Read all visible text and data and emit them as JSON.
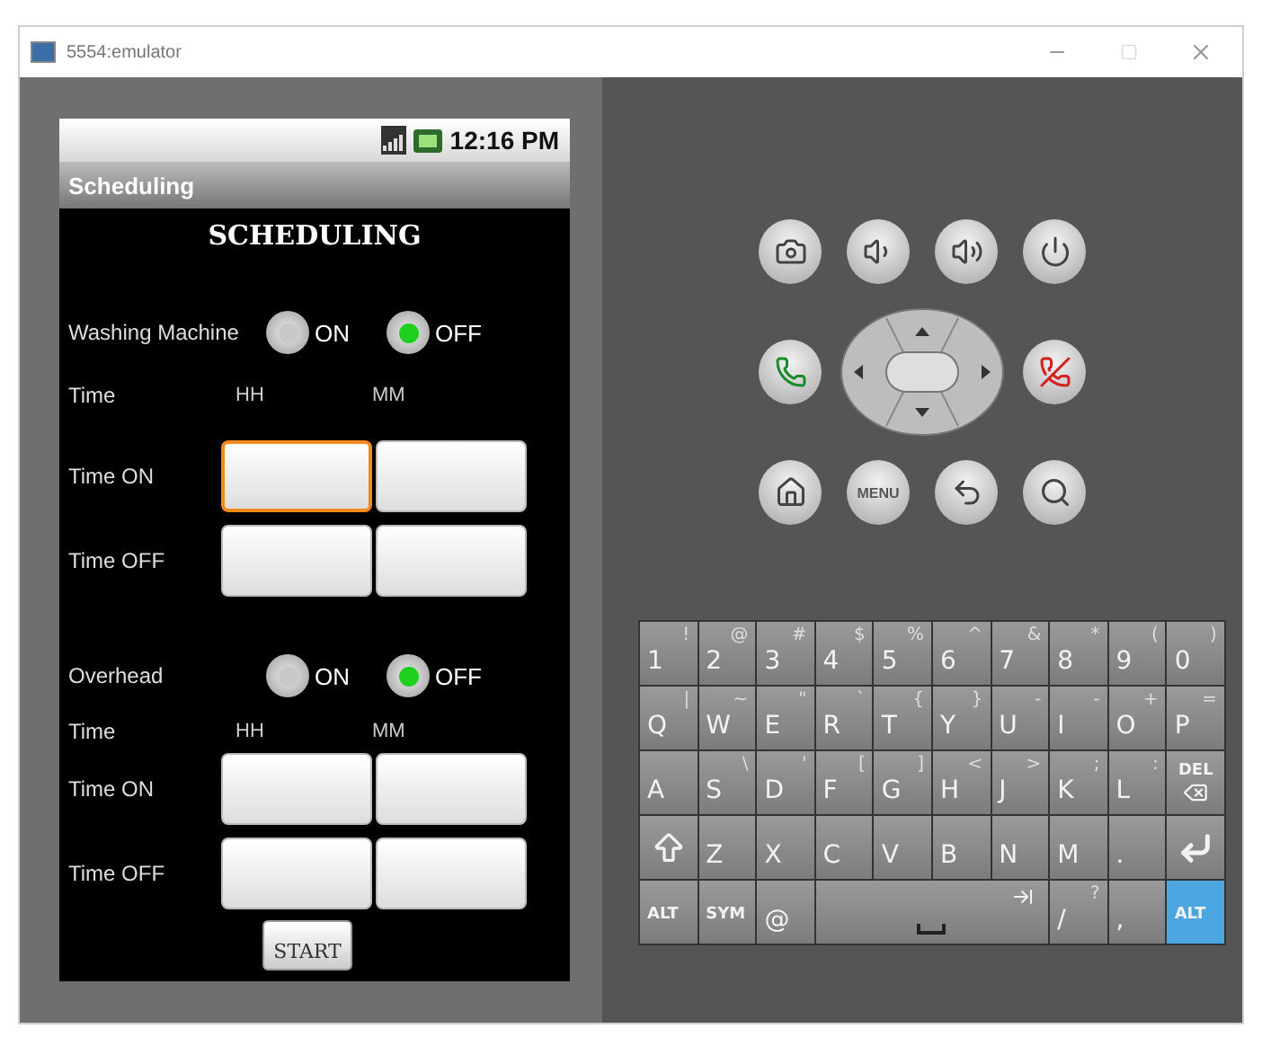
{
  "window": {
    "title": "5554:emulator"
  },
  "phone": {
    "status_time": "12:16 PM",
    "app_title": "Scheduling",
    "heading": "SCHEDULING",
    "devices": [
      {
        "name": "Washing Machine",
        "options": [
          {
            "label": "ON",
            "selected": false
          },
          {
            "label": "OFF",
            "selected": true
          }
        ],
        "time_label": "Time",
        "columns": [
          "HH",
          "MM"
        ],
        "rows": [
          {
            "label": "Time ON",
            "fields": [
              {
                "focused": true
              },
              {
                "focused": false
              }
            ]
          },
          {
            "label": "Time OFF",
            "fields": [
              {
                "focused": false
              },
              {
                "focused": false
              }
            ]
          }
        ]
      },
      {
        "name": "Overhead",
        "options": [
          {
            "label": "ON",
            "selected": false
          },
          {
            "label": "OFF",
            "selected": true
          }
        ],
        "time_label": "Time",
        "columns": [
          "HH",
          "MM"
        ],
        "rows": [
          {
            "label": "Time ON",
            "fields": [
              {
                "focused": false
              },
              {
                "focused": false
              }
            ]
          },
          {
            "label": "Time OFF",
            "fields": [
              {
                "focused": false
              },
              {
                "focused": false
              }
            ]
          }
        ]
      }
    ],
    "start_button": "START"
  },
  "hardware_buttons": [
    [
      {
        "kind": "camera"
      },
      {
        "kind": "volume-down"
      },
      {
        "kind": "volume-up"
      },
      {
        "kind": "power"
      }
    ],
    [
      {
        "kind": "call"
      },
      {
        "kind": "dpad"
      },
      {
        "kind": "end-call"
      }
    ],
    [
      {
        "kind": "home"
      },
      {
        "kind": "menu",
        "label": "MENU"
      },
      {
        "kind": "back"
      },
      {
        "kind": "search"
      }
    ]
  ],
  "keyboard": [
    [
      {
        "kind": "char",
        "main": "1",
        "alt": "!"
      },
      {
        "kind": "char",
        "main": "2",
        "alt": "@"
      },
      {
        "kind": "char",
        "main": "3",
        "alt": "#"
      },
      {
        "kind": "char",
        "main": "4",
        "alt": "$"
      },
      {
        "kind": "char",
        "main": "5",
        "alt": "%"
      },
      {
        "kind": "char",
        "main": "6",
        "alt": "^"
      },
      {
        "kind": "char",
        "main": "7",
        "alt": "&"
      },
      {
        "kind": "char",
        "main": "8",
        "alt": "*"
      },
      {
        "kind": "char",
        "main": "9",
        "alt": "("
      },
      {
        "kind": "char",
        "main": "0",
        "alt": ")"
      }
    ],
    [
      {
        "kind": "char",
        "main": "Q",
        "alt": "|"
      },
      {
        "kind": "char",
        "main": "W",
        "alt": "~"
      },
      {
        "kind": "char",
        "main": "E",
        "alt": "\""
      },
      {
        "kind": "char",
        "main": "R",
        "alt": "`"
      },
      {
        "kind": "char",
        "main": "T",
        "alt": "{"
      },
      {
        "kind": "char",
        "main": "Y",
        "alt": "}"
      },
      {
        "kind": "char",
        "main": "U",
        "alt": "-"
      },
      {
        "kind": "char",
        "main": "I",
        "alt": "-"
      },
      {
        "kind": "char",
        "main": "O",
        "alt": "+"
      },
      {
        "kind": "char",
        "main": "P",
        "alt": "="
      }
    ],
    [
      {
        "kind": "char",
        "main": "A"
      },
      {
        "kind": "char",
        "main": "S",
        "alt": "\\"
      },
      {
        "kind": "char",
        "main": "D",
        "alt": "'"
      },
      {
        "kind": "char",
        "main": "F",
        "alt": "["
      },
      {
        "kind": "char",
        "main": "G",
        "alt": "]"
      },
      {
        "kind": "char",
        "main": "H",
        "alt": "<"
      },
      {
        "kind": "char",
        "main": "J",
        "alt": ">"
      },
      {
        "kind": "char",
        "main": "K",
        "alt": ";"
      },
      {
        "kind": "char",
        "main": "L",
        "alt": ":"
      },
      {
        "kind": "delete",
        "main": "DEL"
      }
    ],
    [
      {
        "kind": "shift"
      },
      {
        "kind": "char",
        "main": "Z"
      },
      {
        "kind": "char",
        "main": "X"
      },
      {
        "kind": "char",
        "main": "C"
      },
      {
        "kind": "char",
        "main": "V"
      },
      {
        "kind": "char",
        "main": "B"
      },
      {
        "kind": "char",
        "main": "N"
      },
      {
        "kind": "char",
        "main": "M"
      },
      {
        "kind": "char",
        "main": "."
      },
      {
        "kind": "enter"
      }
    ],
    [
      {
        "kind": "modifier",
        "main": "ALT",
        "on": false
      },
      {
        "kind": "modifier",
        "main": "SYM",
        "on": false
      },
      {
        "kind": "char",
        "main": "@"
      },
      {
        "kind": "space"
      },
      {
        "kind": "char",
        "main": "/",
        "alt": "?"
      },
      {
        "kind": "char",
        "main": ","
      },
      {
        "kind": "modifier",
        "main": "ALT",
        "on": true
      }
    ]
  ]
}
